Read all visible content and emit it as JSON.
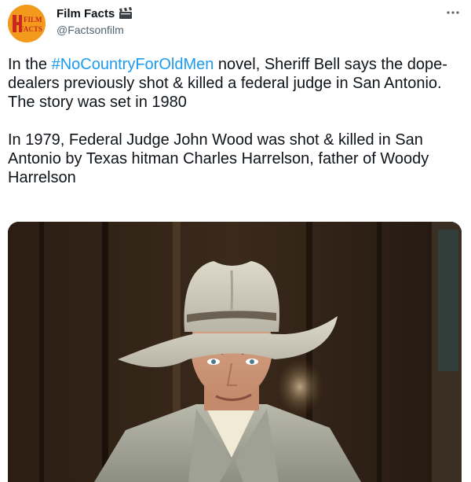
{
  "account": {
    "display_name": "Film Facts",
    "handle": "@Factsonfilm",
    "avatar_text_line1": "FILM",
    "avatar_text_line2": "FACTS",
    "name_emoji_icon": "clapper-board-icon"
  },
  "tweet": {
    "paragraph1_before": "In the ",
    "hashtag": "#NoCountryForOldMen",
    "paragraph1_after": " novel, Sheriff Bell says the dope-dealers previously shot & killed a federal judge in San Antonio. The story was set in 1980",
    "paragraph2": "In 1979, Federal Judge John Wood was shot & killed in San Antonio by Texas hitman Charles Harrelson, father of Woody Harrelson"
  },
  "media": {
    "kind": "photo"
  },
  "icons": {
    "more": "more-horizontal-icon"
  },
  "colors": {
    "link": "#1d9bf0",
    "text": "#0f1419",
    "secondary": "#536471",
    "avatar_bg": "#f39a1c"
  }
}
